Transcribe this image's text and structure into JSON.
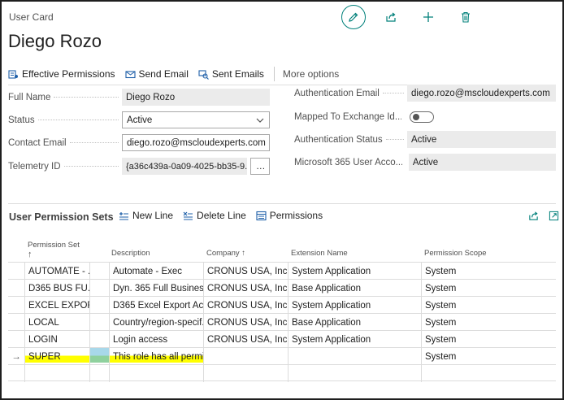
{
  "header": {
    "card_label": "User Card",
    "title": "Diego Rozo"
  },
  "top_actions": {
    "edit_icon": "pencil-icon",
    "share_icon": "share-icon",
    "new_icon": "plus-icon",
    "delete_icon": "trash-icon"
  },
  "action_bar": {
    "effective_permissions": "Effective Permissions",
    "send_email": "Send Email",
    "sent_emails": "Sent Emails",
    "more_options": "More options"
  },
  "fields": {
    "full_name": {
      "label": "Full Name",
      "value": "Diego Rozo"
    },
    "status": {
      "label": "Status",
      "value": "Active"
    },
    "contact_email": {
      "label": "Contact Email",
      "value": "diego.rozo@mscloudexperts.com"
    },
    "telemetry_id": {
      "label": "Telemetry ID",
      "value": "{a36c439a-0a09-4025-bb35-9...",
      "more": "…"
    },
    "authentication_email": {
      "label": "Authentication Email",
      "value": "diego.rozo@mscloudexperts.com"
    },
    "mapped_to_exchange": {
      "label": "Mapped To Exchange Id...",
      "value": false
    },
    "authentication_status": {
      "label": "Authentication Status",
      "value": "Active"
    },
    "m365_user_access": {
      "label": "Microsoft 365 User Acco...",
      "value": "Active"
    }
  },
  "subpage": {
    "title": "User Permission Sets",
    "new_line": "New Line",
    "delete_line": "Delete Line",
    "permissions": "Permissions"
  },
  "grid": {
    "columns": {
      "permission_set": "Permission Set",
      "permission_set_sort": "↑",
      "description": "Description",
      "company": "Company ↑",
      "extension_name": "Extension Name",
      "permission_scope": "Permission Scope"
    },
    "rows": [
      {
        "marker": "",
        "permission_set": "AUTOMATE - ...",
        "description": "Automate - Exec",
        "company": "CRONUS USA, Inc.",
        "extension": "System Application",
        "scope": "System"
      },
      {
        "marker": "",
        "permission_set": "D365 BUS FU...",
        "description": "Dyn. 365 Full Business...",
        "company": "CRONUS USA, Inc.",
        "extension": "Base Application",
        "scope": "System"
      },
      {
        "marker": "",
        "permission_set": "EXCEL EXPOR...",
        "description": "D365 Excel Export Act...",
        "company": "CRONUS USA, Inc.",
        "extension": "System Application",
        "scope": "System"
      },
      {
        "marker": "",
        "permission_set": "LOCAL",
        "description": "Country/region-specif...",
        "company": "CRONUS USA, Inc.",
        "extension": "Base Application",
        "scope": "System"
      },
      {
        "marker": "",
        "permission_set": "LOGIN",
        "description": "Login access",
        "company": "CRONUS USA, Inc.",
        "extension": "System Application",
        "scope": "System"
      },
      {
        "marker": "→",
        "permission_set": "SUPER",
        "description": "This role has all permi...",
        "company": "",
        "extension": "",
        "scope": "System"
      },
      {
        "marker": "",
        "permission_set": "",
        "description": "",
        "company": "",
        "extension": "",
        "scope": ""
      }
    ]
  },
  "colors": {
    "accent": "#00807a",
    "highlight": "#ffff00",
    "highlight_green": "#8fd19e"
  }
}
